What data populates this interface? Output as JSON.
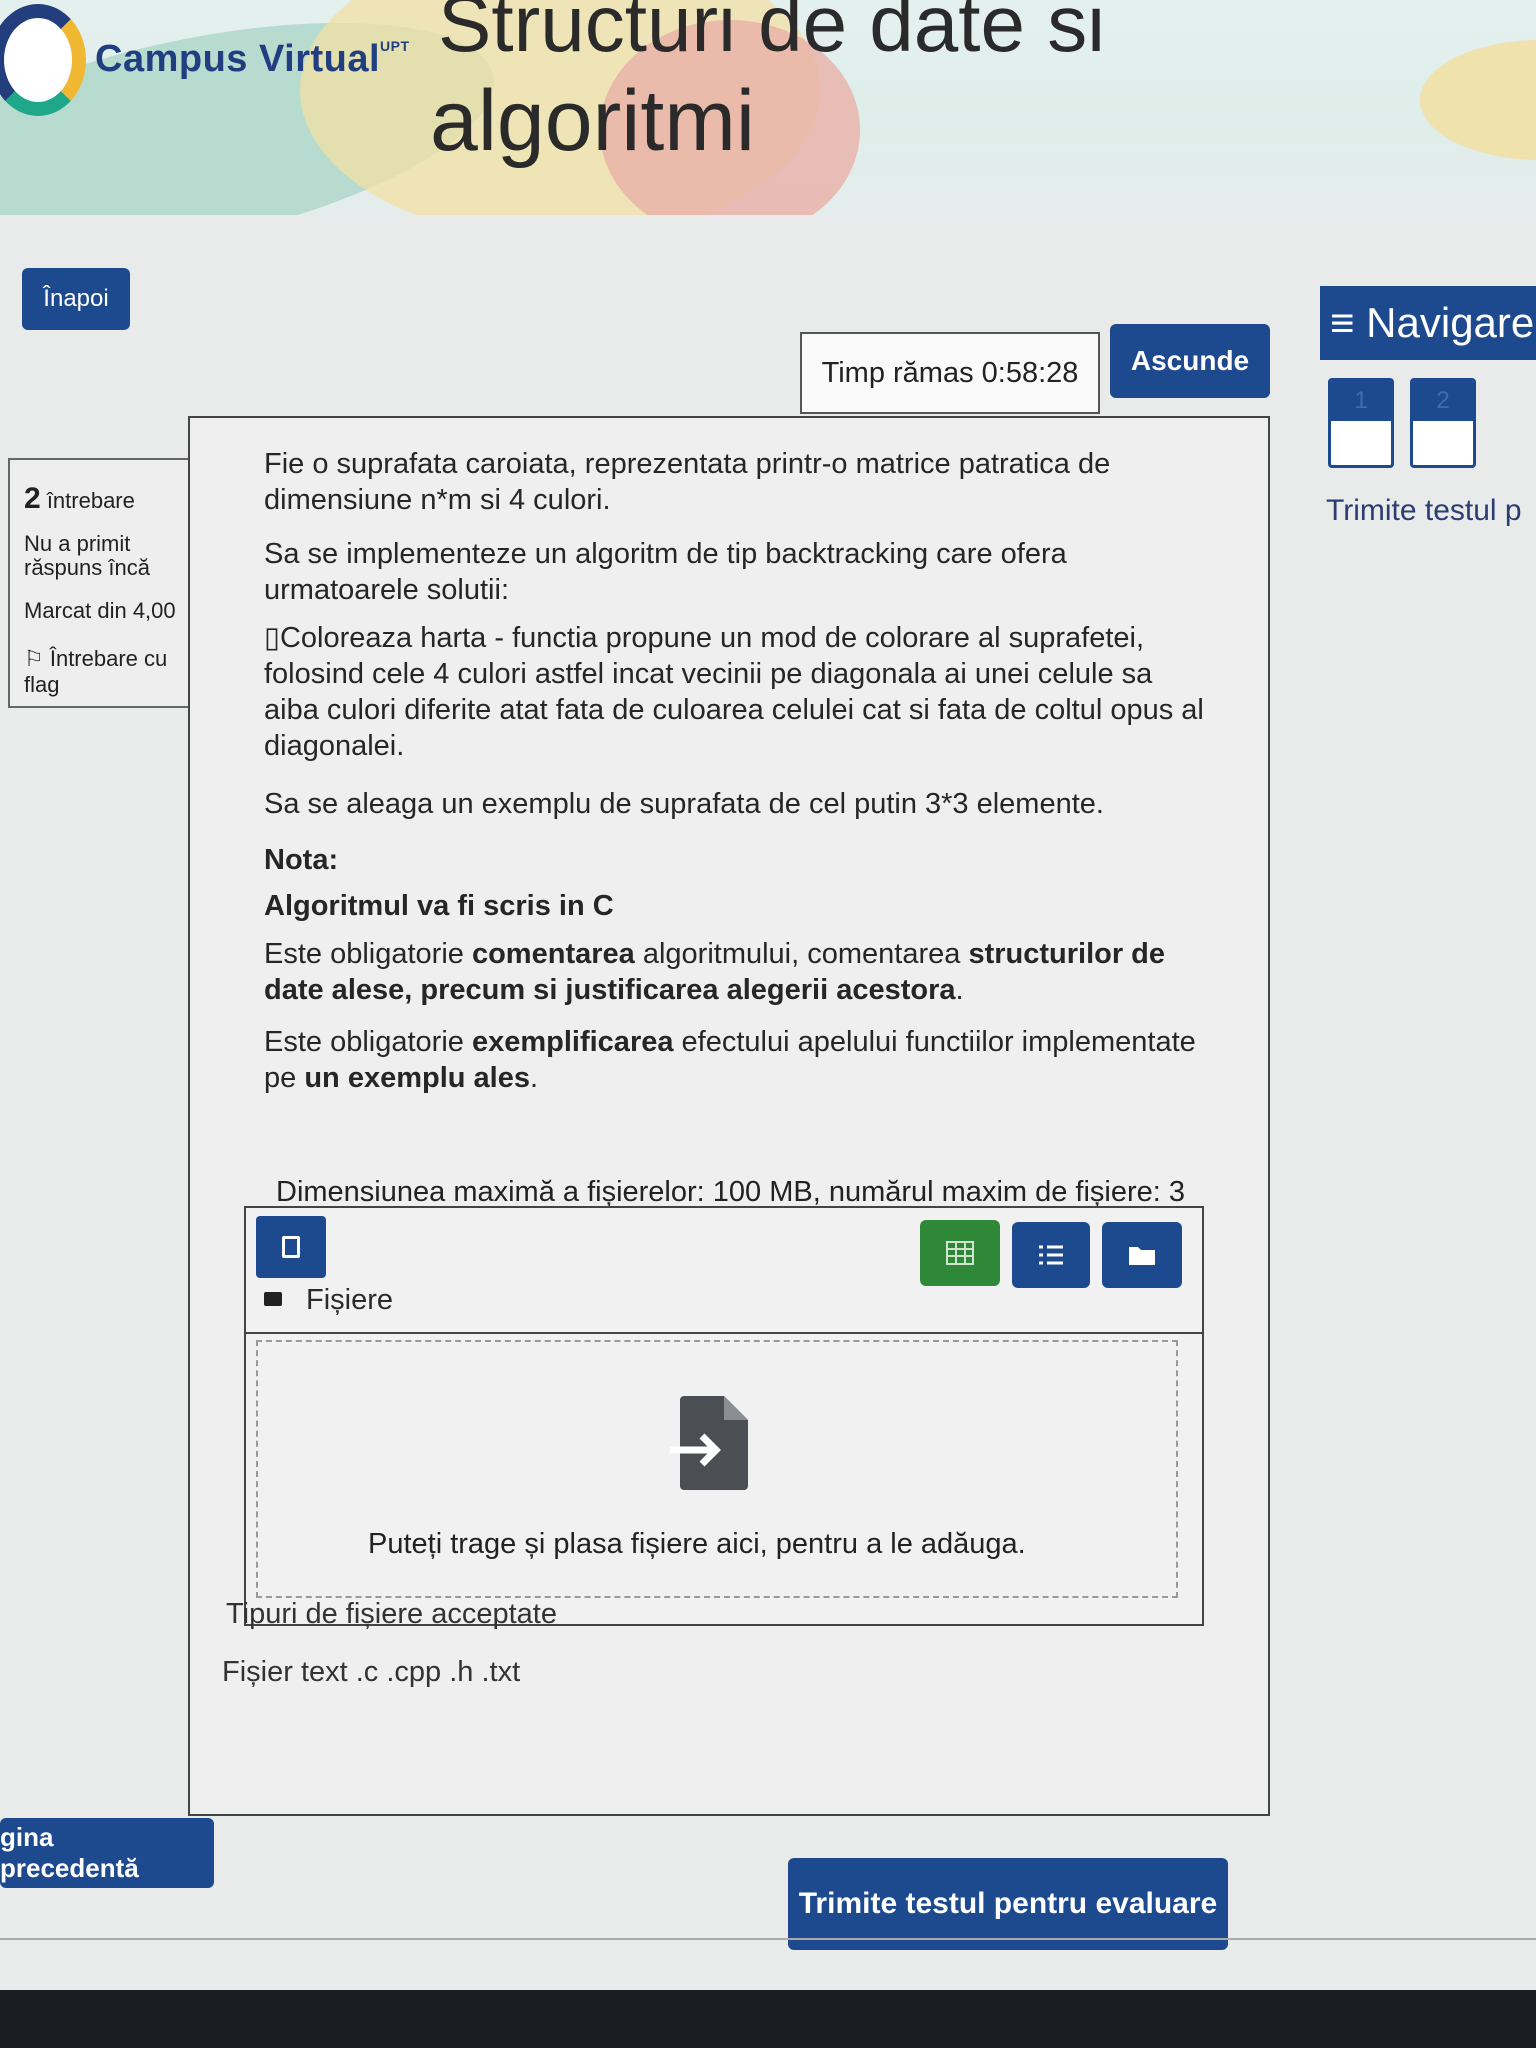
{
  "header": {
    "logo_text": "Campus Virtual",
    "logo_superscript": "UPT",
    "course_title_line1": "Structuri de date si",
    "course_title_line2": "algoritmi"
  },
  "toolbar": {
    "back_label": "Înapoi",
    "timer_text": "Timp rămas 0:58:28",
    "hide_label": "Ascunde"
  },
  "navigation": {
    "title": "≡ Navigare",
    "questions": [
      "1",
      "2"
    ],
    "finish_link": "Trimite testul p"
  },
  "question_info": {
    "number": "2",
    "number_suffix": "întrebare",
    "status": "Nu a primit răspuns încă",
    "marks": "Marcat din 4,00",
    "flag_label": "Întrebare cu flag"
  },
  "question": {
    "line1": "Fie o suprafata caroiata, reprezentata printr-o matrice patratica de",
    "line2": "dimensiune n*m si 4 culori.",
    "line3": "Sa se implementeze un algoritm de tip backtracking care ofera",
    "line4": "urmatoarele solutii:",
    "line5": "▯Coloreaza harta - functia propune un mod de colorare al suprafetei,",
    "line6": "folosind cele 4 culori astfel incat vecinii pe diagonala ai unei celule sa",
    "line7": "aiba culori diferite atat fata de culoarea celulei cat si fata de coltul opus al",
    "line8": "diagonalei.",
    "line9": "Sa se aleaga un exemplu de suprafata de cel putin 3*3 elemente.",
    "nota": "Nota:",
    "algo": "Algoritmul va fi scris in C",
    "p5_a": "Este obligatorie ",
    "p5_b": "comentarea",
    "p5_c": " algoritmului, comentarea ",
    "p5_d": "structurilor de",
    "p5_e": "date alese, precum si justificarea alegerii acestora",
    "p5_f": ".",
    "p6_a": "Este obligatorie ",
    "p6_b": "exemplificarea",
    "p6_c": " efectului apelului functiilor implementate",
    "p6_d": "pe ",
    "p6_e": "un exemplu ales",
    "p6_f": "."
  },
  "filepicker": {
    "max_size_text": "Dimensiunea maximă a fișierelor: 100 MB, numărul maxim de fișiere: 3",
    "files_label": "Fișiere",
    "drop_text": "Puteți trage și plasa fișiere aici, pentru a le adăuga.",
    "types_label": "Tipuri de fișiere acceptate",
    "types_value": "Fișier text .c .cpp .h .txt"
  },
  "footer": {
    "prev_label": "gina precedentă",
    "submit_label": "Trimite testul pentru evaluare"
  },
  "colors": {
    "primary": "#1d4a8f",
    "green": "#2f8838"
  }
}
